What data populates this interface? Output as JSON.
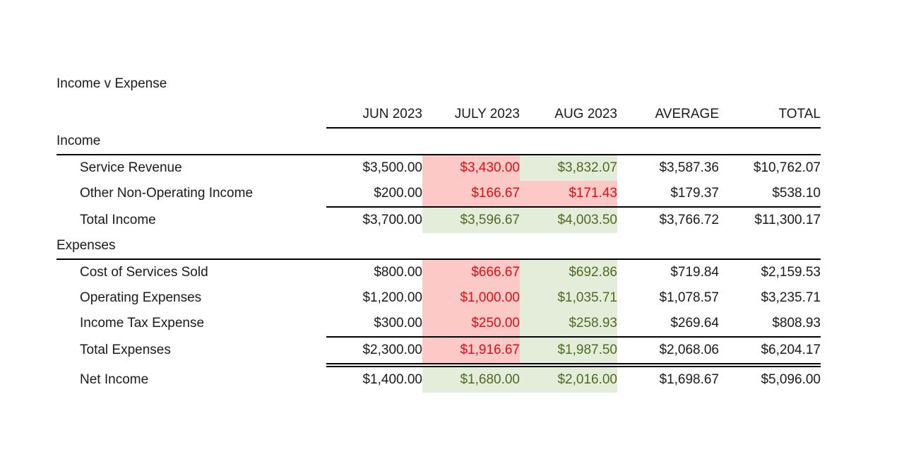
{
  "report": {
    "title": "Income v Expense"
  },
  "table": {
    "columns": [
      "",
      "JUN 2023",
      "JULY 2023",
      "AUG 2023",
      "AVERAGE",
      "TOTAL"
    ],
    "sections": [
      {
        "heading": "Income",
        "rows": [
          {
            "label": "Service Revenue",
            "jun": "$3,500.00",
            "july": "$3,430.00",
            "aug": "$3,832.07",
            "average": "$3,587.36",
            "total": "$10,762.07",
            "july_style": "pink",
            "aug_style": "green"
          },
          {
            "label": "Other Non-Operating Income",
            "jun": "$200.00",
            "july": "$166.67",
            "aug": "$171.43",
            "average": "$179.37",
            "total": "$538.10",
            "july_style": "pink",
            "aug_style": "pink"
          }
        ],
        "total_row": {
          "label": "Total Income",
          "jun": "$3,700.00",
          "july": "$3,596.67",
          "aug": "$4,003.50",
          "average": "$3,766.72",
          "total": "$11,300.17",
          "july_style": "green",
          "aug_style": "green"
        }
      },
      {
        "heading": "Expenses",
        "rows": [
          {
            "label": "Cost of Services Sold",
            "jun": "$800.00",
            "july": "$666.67",
            "aug": "$692.86",
            "average": "$719.84",
            "total": "$2,159.53",
            "july_style": "pink",
            "aug_style": "green"
          },
          {
            "label": "Operating Expenses",
            "jun": "$1,200.00",
            "july": "$1,000.00",
            "aug": "$1,035.71",
            "average": "$1,078.57",
            "total": "$3,235.71",
            "july_style": "pink",
            "aug_style": "green"
          },
          {
            "label": "Income Tax Expense",
            "jun": "$300.00",
            "july": "$250.00",
            "aug": "$258.93",
            "average": "$269.64",
            "total": "$808.93",
            "july_style": "pink",
            "aug_style": "green"
          }
        ],
        "total_row": {
          "label": "Total Expenses",
          "jun": "$2,300.00",
          "july": "$1,916.67",
          "aug": "$1,987.50",
          "average": "$2,068.06",
          "total": "$6,204.17",
          "july_style": "pink",
          "aug_style": "green"
        }
      }
    ],
    "net_row": {
      "label": "Net Income",
      "jun": "$1,400.00",
      "july": "$1,680.00",
      "aug": "$2,016.00",
      "average": "$1,698.67",
      "total": "$5,096.00",
      "july_style": "green",
      "aug_style": "green"
    }
  },
  "colors": {
    "highlight_pink_bg": "#FCC9C6",
    "highlight_pink_text": "#DF0F12",
    "highlight_green_bg": "#E3EDD9",
    "highlight_green_text": "#4E6B22",
    "text": "#1A1A1A",
    "rule": "#000000"
  }
}
